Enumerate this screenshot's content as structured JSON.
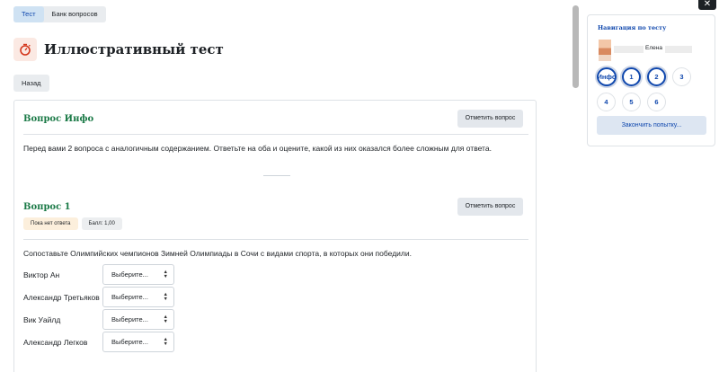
{
  "tabs": [
    {
      "label": "Тест",
      "active": true
    },
    {
      "label": "Банк вопросов",
      "active": false
    }
  ],
  "page": {
    "title": "Иллюстративный тест",
    "back_label": "Назад",
    "icon": "stopwatch-icon"
  },
  "questions": {
    "info": {
      "title": "Вопрос Инфо",
      "flag_label": "Отметить вопрос",
      "text": "Перед вами 2 вопроса с аналогичным содержанием. Ответьте на оба и оцените, какой из них оказался более сложным для ответа."
    },
    "q1": {
      "title": "Вопрос 1",
      "flag_label": "Отметить вопрос",
      "status": "Пока нет ответа",
      "grade": "Балл: 1,00",
      "text": "Сопоставьте Олимпийских чемпионов Зимней Олимпиады в Сочи с видами спорта, в которых они победили.",
      "rows": [
        {
          "label": "Виктор Ан",
          "value": "Выберите..."
        },
        {
          "label": "Александр Третьяков",
          "value": "Выберите..."
        },
        {
          "label": "Вик Уайлд",
          "value": "Выберите..."
        },
        {
          "label": "Александр Легков",
          "value": "Выберите..."
        }
      ]
    }
  },
  "nav": {
    "title": "Навигация по тесту",
    "user_name": "Елена",
    "buttons": [
      "Инфо",
      "1",
      "2",
      "3",
      "4",
      "5",
      "6"
    ],
    "finish_label": "Закончить попытку...",
    "close_icon": "close-icon"
  },
  "colors": {
    "accent": "#0f47ad",
    "question_title": "#1b7a47",
    "status_badge": "#fcefdc",
    "icon_bg": "#fbe9e3",
    "icon_fg": "#d4381e"
  }
}
